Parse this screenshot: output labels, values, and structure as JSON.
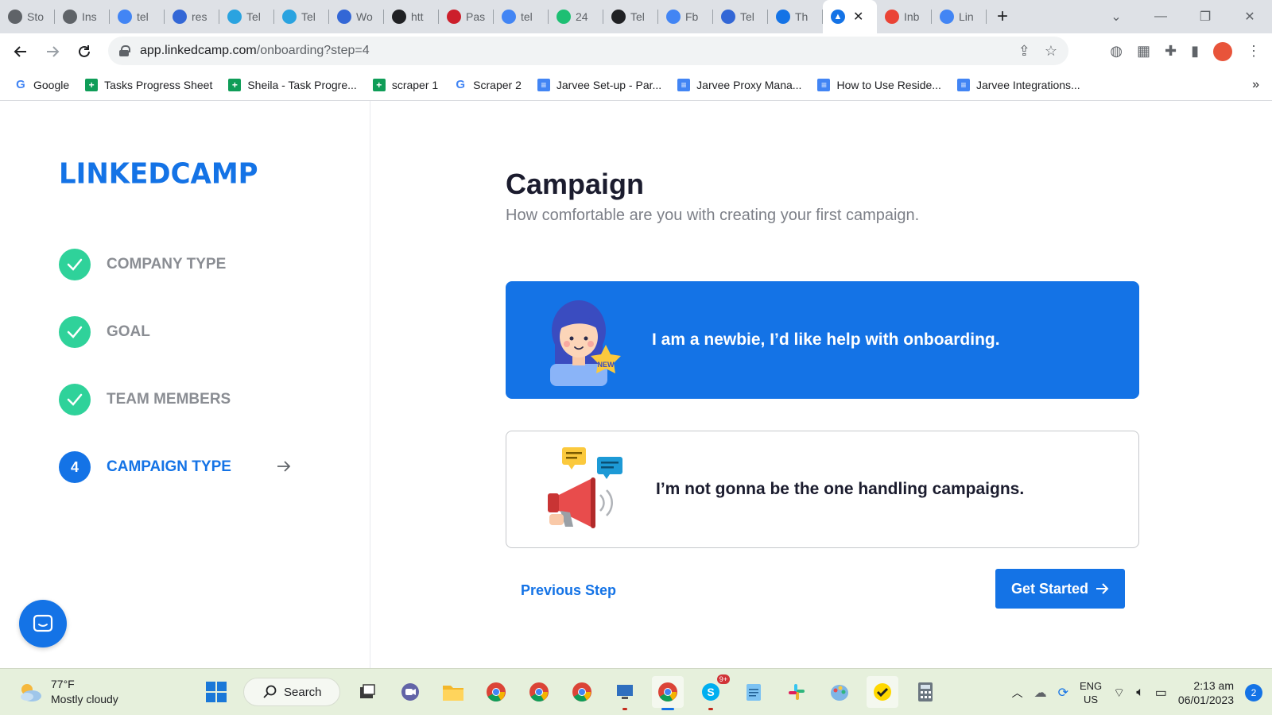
{
  "browser": {
    "tabs": [
      {
        "title": "Sto",
        "icon": "ghost-icon",
        "color": "#5f6368"
      },
      {
        "title": "Ins",
        "icon": "ghost-icon",
        "color": "#5f6368"
      },
      {
        "title": "tel",
        "icon": "google-icon",
        "color": "#4285f4"
      },
      {
        "title": "res",
        "icon": "check-icon",
        "color": "#3367d6"
      },
      {
        "title": "Tel",
        "icon": "telegram-icon",
        "color": "#2aa3e0"
      },
      {
        "title": "Tel",
        "icon": "telegram-icon",
        "color": "#2aa3e0"
      },
      {
        "title": "Wo",
        "icon": "check-icon",
        "color": "#3367d6"
      },
      {
        "title": "htt",
        "icon": "b-icon",
        "color": "#202124"
      },
      {
        "title": "Pas",
        "icon": "lastpass-icon",
        "color": "#cc1f2b"
      },
      {
        "title": "tel",
        "icon": "google-icon",
        "color": "#4285f4"
      },
      {
        "title": "24",
        "icon": "fiverr-icon",
        "color": "#1dbf73"
      },
      {
        "title": "Tel",
        "icon": "bw-icon",
        "color": "#202124"
      },
      {
        "title": "Fb",
        "icon": "google-icon",
        "color": "#4285f4"
      },
      {
        "title": "Tel",
        "icon": "sync-icon",
        "color": "#3367d6"
      },
      {
        "title": "Th",
        "icon": "rocket-icon",
        "color": "#1473e6"
      }
    ],
    "active_tab": {
      "icon": "rocket-icon",
      "close": "✕"
    },
    "trailing_tabs": [
      {
        "title": "Inb",
        "icon": "gmail-icon",
        "color": "#ea4335"
      },
      {
        "title": "Lin",
        "icon": "doc-icon",
        "color": "#4285f4"
      }
    ],
    "url_host": "app.linkedcamp.com",
    "url_path": "/onboarding?step=4",
    "bookmarks": [
      {
        "label": "Google",
        "type": "google"
      },
      {
        "label": "Tasks Progress Sheet",
        "type": "sheet"
      },
      {
        "label": "Sheila - Task Progre...",
        "type": "sheet"
      },
      {
        "label": "scraper 1",
        "type": "sheet"
      },
      {
        "label": "Scraper 2",
        "type": "google"
      },
      {
        "label": "Jarvee Set-up - Par...",
        "type": "doc"
      },
      {
        "label": "Jarvee Proxy Mana...",
        "type": "doc"
      },
      {
        "label": "How to Use Reside...",
        "type": "doc"
      },
      {
        "label": "Jarvee Integrations...",
        "type": "doc"
      }
    ]
  },
  "app": {
    "logo": "LINKEDCAMP",
    "steps": [
      {
        "label": "COMPANY TYPE",
        "status": "done"
      },
      {
        "label": "GOAL",
        "status": "done"
      },
      {
        "label": "TEAM MEMBERS",
        "status": "done"
      },
      {
        "label": "CAMPAIGN TYPE",
        "status": "current",
        "number": "4"
      }
    ],
    "title": "Campaign",
    "subtitle": "How comfortable are you with creating your first campaign.",
    "options": [
      {
        "label": "I am a newbie, I’d like help with onboarding.",
        "selected": true,
        "badge": "NEW"
      },
      {
        "label": "I’m not gonna be the one handling campaigns.",
        "selected": false
      }
    ],
    "previous_label": "Previous Step",
    "get_started_label": "Get Started",
    "accent_color": "#1473e6",
    "success_color": "#2fd29a"
  },
  "taskbar": {
    "weather_temp": "77°F",
    "weather_desc": "Mostly cloudy",
    "search_label": "Search",
    "lang_line1": "ENG",
    "lang_line2": "US",
    "time": "2:13 am",
    "date": "06/01/2023",
    "notifications": "2",
    "skype_badge": "9+"
  }
}
